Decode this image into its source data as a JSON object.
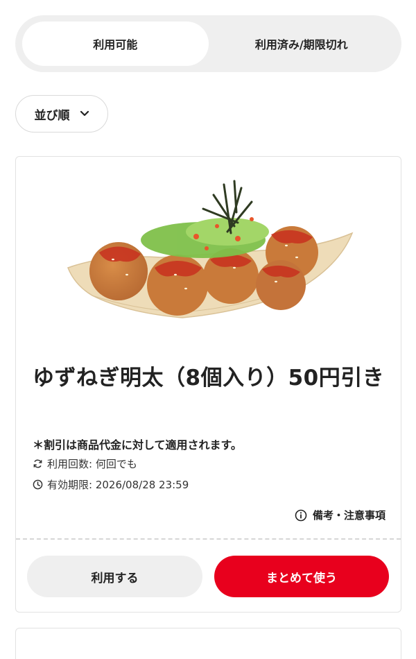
{
  "tabs": [
    {
      "label": "利用可能",
      "active": true
    },
    {
      "label": "利用済み/期限切れ",
      "active": false
    }
  ],
  "sort": {
    "label": "並び順",
    "icon": "chevron-down-icon"
  },
  "coupon": {
    "title": "ゆずねぎ明太（8個入り）50円引き",
    "note": "＊割引は商品代金に対して適用されます。",
    "uses": "利用回数: 何回でも",
    "expiry": "有効期限: 2026/08/28 23:59",
    "remarks_label": "備考・注意事項",
    "use_label": "利用する",
    "bulk_label": "まとめて使う"
  },
  "colors": {
    "accent": "#e8001d",
    "tab_bg": "#efefef"
  }
}
